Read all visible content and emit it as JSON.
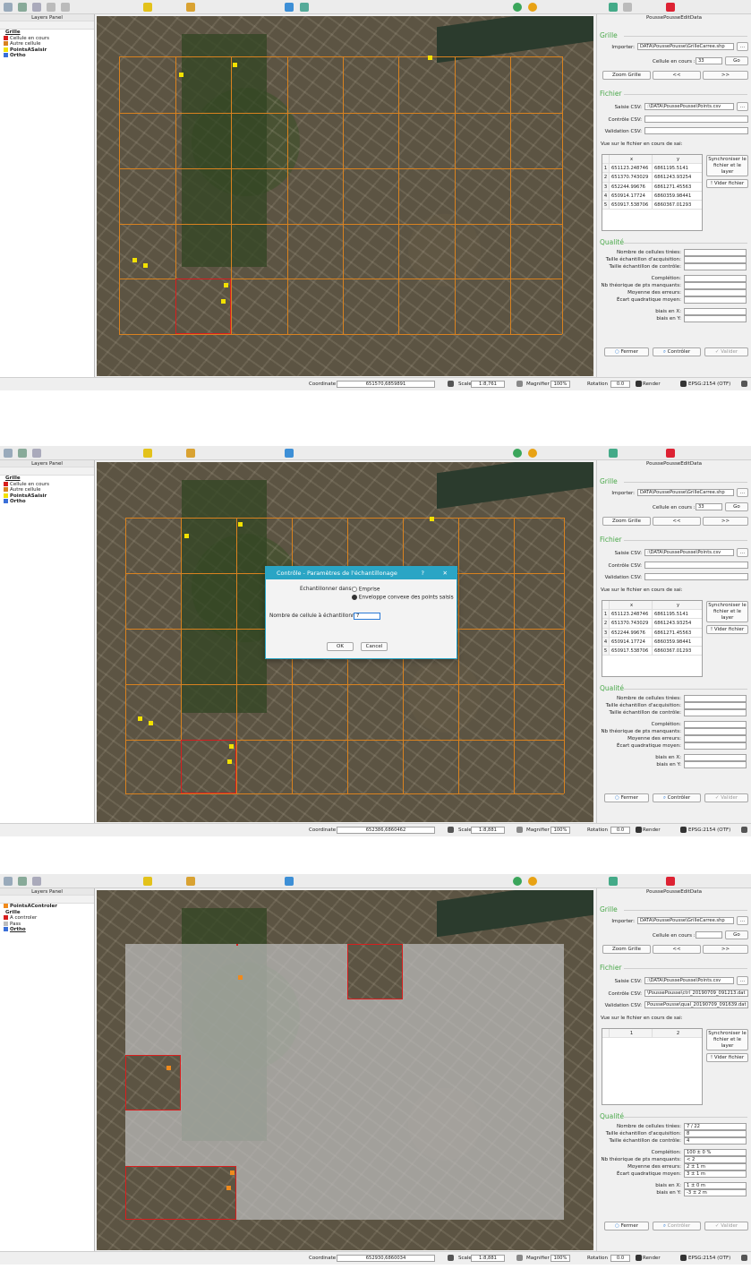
{
  "layers_panel": {
    "title": "Layers Panel",
    "p1": [
      {
        "label": "Grille",
        "style": "bold-underline",
        "swatch": ""
      },
      {
        "label": "Cellule en cours",
        "style": "",
        "swatch": "#d81e1e"
      },
      {
        "label": "Autre cellule",
        "style": "",
        "swatch": "#d9821f"
      },
      {
        "label": "PointsASaisir",
        "style": "bold",
        "swatch": "#f2e100"
      },
      {
        "label": "Ortho",
        "style": "bold",
        "swatch": "#3a6fd8"
      }
    ],
    "p2": [
      {
        "label": "Grille",
        "style": "bold-underline",
        "swatch": ""
      },
      {
        "label": "Cellule en cours",
        "style": "",
        "swatch": "#d81e1e"
      },
      {
        "label": "Autre cellule",
        "style": "",
        "swatch": "#d9821f"
      },
      {
        "label": "PointsASaisir",
        "style": "bold",
        "swatch": "#f2e100"
      },
      {
        "label": "Ortho",
        "style": "bold",
        "swatch": "#3a6fd8"
      }
    ],
    "p3": [
      {
        "label": "PointsAControler",
        "style": "bold",
        "swatch": "#f08a1c"
      },
      {
        "label": "Grille",
        "style": "bold",
        "swatch": ""
      },
      {
        "label": "A controler",
        "style": "",
        "swatch": "#d81e1e"
      },
      {
        "label": "Pass",
        "style": "",
        "swatch": "#bdbdbd"
      },
      {
        "label": "Ortho",
        "style": "bold-underline",
        "swatch": "#3a6fd8"
      }
    ]
  },
  "plugin": {
    "title": "PoussePousseEditData",
    "grille_group": "Grille",
    "importer_label": "Importer:",
    "cellule_label": "Cellule en cours :",
    "go_label": "Go",
    "zoom_label": "Zoom Grille",
    "prev_label": "<<",
    "next_label": ">>",
    "browse_label": "...",
    "fichier_group": "Fichier",
    "saisie_label": "Saisie CSV:",
    "controle_label": "Contrôle CSV:",
    "validation_label": "Validation CSV:",
    "vue_label": "Vue sur le fichier en cours de sai:",
    "col_x": "x",
    "col_y": "y",
    "sync_label": "Synchroniser le fichier et le layer",
    "vider_label": "! Vider fichier",
    "qualite_group": "Qualité",
    "q_labels": [
      "Nombre de cellules tirées:",
      "Taille échantillon d'acquisition:",
      "Taille échantillon de contrôle:",
      "Complétion:",
      "Nb théorique de pts manquants:",
      "Moyenne des erreurs:",
      "Écart quadratique moyen:",
      "biais en X:",
      "biais en Y:"
    ],
    "fermer_label": "Fermer",
    "controler_label": "Contrôler",
    "valider_label": "Valider"
  },
  "panel1": {
    "importer_value": "DATA\\PoussePousse\\GrilleCarree.shp",
    "cellule_value": "33",
    "saisie_value": ":\\DATA\\PoussePousse\\Points.csv",
    "controle_value": "",
    "validation_value": "",
    "rows": [
      [
        "1",
        "651123.248746",
        "6861195.5141"
      ],
      [
        "2",
        "651370.743029",
        "6861243.93254"
      ],
      [
        "3",
        "652244.99676",
        "6861271.45563"
      ],
      [
        "4",
        "650914.17724",
        "6860359.98441"
      ],
      [
        "5",
        "650917.538706",
        "6860367.01293"
      ]
    ],
    "q_values": [
      "",
      "",
      "",
      "",
      "",
      "",
      "",
      "",
      ""
    ],
    "coordinate": "651570,6859891",
    "scale": "1:8,761"
  },
  "panel2": {
    "importer_value": "DATA\\PoussePousse\\GrilleCarree.shp",
    "cellule_value": "33",
    "saisie_value": ":\\DATA\\PoussePousse\\Points.csv",
    "controle_value": "",
    "validation_value": "",
    "rows": [
      [
        "1",
        "651123.248746",
        "6861195.5141"
      ],
      [
        "2",
        "651370.743029",
        "6861243.93254"
      ],
      [
        "3",
        "652244.99676",
        "6861271.45563"
      ],
      [
        "4",
        "650914.17724",
        "6860359.98441"
      ],
      [
        "5",
        "650917.538706",
        "6860367.01293"
      ]
    ],
    "q_values": [
      "",
      "",
      "",
      "",
      "",
      "",
      "",
      "",
      ""
    ],
    "coordinate": "652386,6860462",
    "scale": "1:8,881"
  },
  "panel3": {
    "importer_value": "DATA\\PoussePousse\\GrilleCarree.shp",
    "cellule_value": "",
    "saisie_value": ":\\DATA\\PoussePousse\\Points.csv",
    "controle_value": "\\PoussePousse\\ctrl_20190709_091213.dat",
    "validation_value": "PoussePousse\\qual_20190709_091639.dat",
    "col_1": "1",
    "col_2": "2",
    "q_values": [
      "7 / 22",
      "8",
      "4",
      "100 ± 0 %",
      "< 2",
      "2 ± 1 m",
      "3 ± 1 m",
      "1 ± 0 m",
      "-3 ± 2 m"
    ],
    "coordinate": "652930,6860034",
    "scale": "1:8,881"
  },
  "status": {
    "coordinate_label": "Coordinate",
    "scale_label": "Scale",
    "magnifier_label": "Magnifier",
    "magnifier_value": "100%",
    "rotation_label": "Rotation",
    "rotation_value": "0.0",
    "render_label": "Render",
    "crs_label": "EPSG:2154 (OTF)"
  },
  "dialog": {
    "title": "Contrôle - Paramètres de l'échantillonage",
    "help": "?",
    "close": "✕",
    "echant_label": "Echantillonner dans:",
    "opt1": "Emprise",
    "opt2": "Enveloppe convexe des points saisis",
    "nb_label": "Nombre de cellule à échantillonner:",
    "nb_value": "7",
    "ok": "OK",
    "cancel": "Cancel"
  },
  "icons": [
    "select-icon",
    "pan-icon",
    "zoom-icon",
    "identify-icon",
    "measure-icon",
    "python-icon",
    "plugin-icon",
    "refresh-icon"
  ]
}
